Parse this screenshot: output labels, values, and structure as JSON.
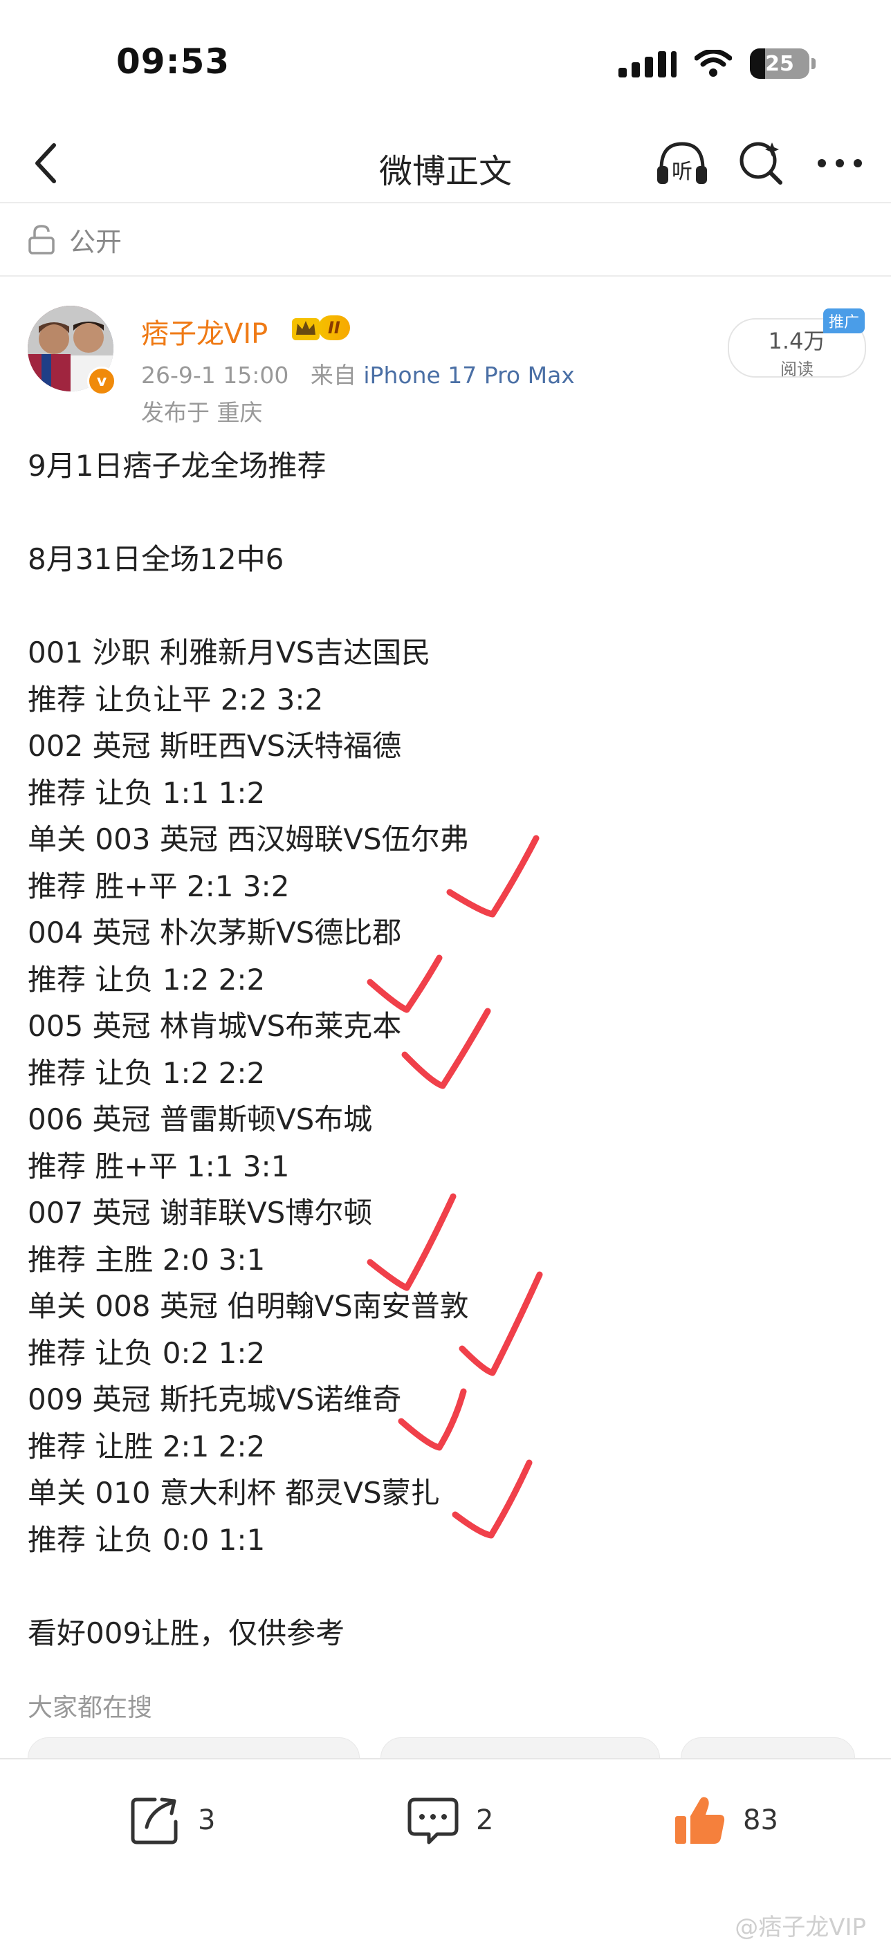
{
  "status_bar": {
    "time": "09:53",
    "battery": "25",
    "battery_level": 0.25
  },
  "nav": {
    "title": "微博正文",
    "icons": [
      "back-icon",
      "listen-icon",
      "search-icon",
      "more-icon"
    ],
    "listen_label": "听"
  },
  "visibility": {
    "label": "公开"
  },
  "author": {
    "name": "痞子龙VIP",
    "vip_level": "II",
    "verified_badge": "v",
    "date": "26-9-1 15:00",
    "source_prefix": "来自",
    "device": "iPhone 17 Pro Max",
    "location": "发布于 重庆",
    "reads": "1.4万",
    "reads_label": "阅读",
    "promo_tag": "推广"
  },
  "post": {
    "lines": [
      "9月1日痞子龙全场推荐",
      "",
      "8月31日全场12中6",
      "",
      "001 沙职 利雅新月VS吉达国民",
      "推荐 让负让平 2:2 3:2",
      "002 英冠 斯旺西VS沃特福德",
      "推荐 让负 1:1 1:2",
      "单关 003 英冠 西汉姆联VS伍尔弗",
      "推荐 胜+平 2:1 3:2",
      "004 英冠 朴次茅斯VS德比郡",
      "推荐 让负 1:2 2:2",
      "005 英冠 林肯城VS布莱克本",
      "推荐 让负 1:2 2:2",
      "006 英冠 普雷斯顿VS布城",
      "推荐 胜+平 1:1 3:1",
      "007 英冠 谢菲联VS博尔顿",
      "推荐 主胜 2:0 3:1",
      "单关 008 英冠 伯明翰VS南安普敦",
      "推荐 让负 0:2 1:2",
      "009 英冠 斯托克城VS诺维奇",
      "推荐 让胜 2:1 2:2",
      "单关 010 意大利杯 都灵VS蒙扎",
      "推荐 让负 0:0 1:1",
      "",
      "看好009让胜，仅供参考"
    ],
    "check_color": "#f0404a"
  },
  "search": {
    "title": "大家都在搜"
  },
  "actions": {
    "share_count": "3",
    "comment_count": "2",
    "like_count": "83",
    "like_color": "#f5803c"
  },
  "watermark": "@痞子龙VIP"
}
